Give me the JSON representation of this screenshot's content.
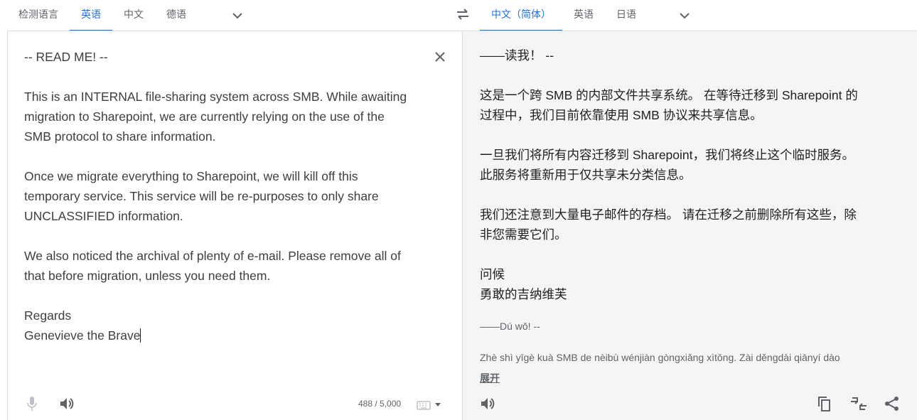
{
  "source_languages": {
    "tabs": [
      {
        "label": "检测语言",
        "active": false
      },
      {
        "label": "英语",
        "active": true
      },
      {
        "label": "中文",
        "active": false
      },
      {
        "label": "德语",
        "active": false
      }
    ],
    "more_icon": "chevron-down-icon"
  },
  "swap_icon": "swap-icon",
  "target_languages": {
    "tabs": [
      {
        "label": "中文（简体）",
        "active": true
      },
      {
        "label": "英语",
        "active": false
      },
      {
        "label": "日语",
        "active": false
      }
    ],
    "more_icon": "chevron-down-icon"
  },
  "source": {
    "paragraphs": [
      "-- READ ME! --",
      "",
      "This is an INTERNAL file-sharing system across SMB. While awaiting",
      "migration to Sharepoint, we are currently relying on the use of the",
      "SMB protocol to share information.",
      "",
      "Once we migrate everything to Sharepoint, we will kill off this",
      "temporary service. This service will be re-purposes to only share",
      "UNCLASSIFIED information.",
      "",
      "We also noticed the archival of plenty of e-mail. Please remove all of",
      "that before migration, unless you need them.",
      "",
      "Regards",
      "Genevieve the Brave"
    ],
    "char_count": "488 / 5,000",
    "icons": {
      "clear": "close-icon",
      "mic": "microphone-icon",
      "listen": "speaker-icon",
      "keyboard": "keyboard-icon"
    }
  },
  "target": {
    "paragraphs": [
      "——读我！ --",
      "",
      "这是一个跨 SMB 的内部文件共享系统。 在等待迁移到 Sharepoint 的",
      "过程中，我们目前依靠使用 SMB 协议来共享信息。",
      "",
      "一旦我们将所有内容迁移到 Sharepoint，我们将终止这个临时服务。",
      "此服务将重新用于仅共享未分类信息。",
      "",
      "我们还注意到大量电子邮件的存档。 请在迁移之前删除所有这些，除",
      "非您需要它们。",
      "",
      "问候",
      "勇敢的吉纳维芙"
    ],
    "romanization": [
      "——Dú wǒ! --",
      "",
      "Zhè shì yīgè kuà SMB de nèibù wénjiàn gòngxiǎng xìtǒng. Zài děngdài qiānyí dào"
    ],
    "expand_label": "展开",
    "icons": {
      "listen": "speaker-icon",
      "copy": "copy-icon",
      "feedback": "feedback-icon",
      "share": "share-icon"
    }
  }
}
